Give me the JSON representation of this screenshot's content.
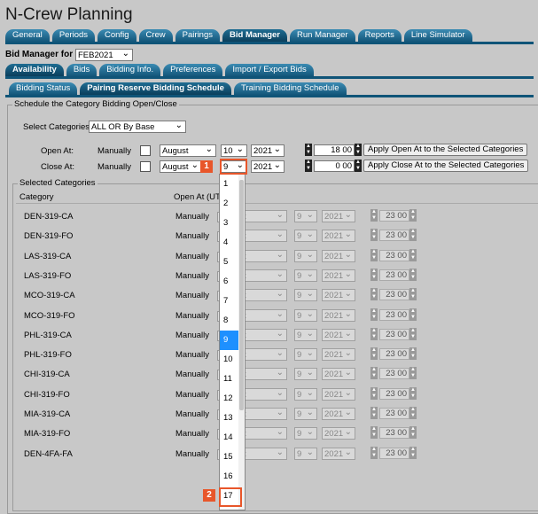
{
  "app_title": "N-Crew Planning",
  "main_tabs": [
    "General",
    "Periods",
    "Config",
    "Crew",
    "Pairings",
    "Bid Manager",
    "Run Manager",
    "Reports",
    "Line Simulator"
  ],
  "active_main_tab": "Bid Manager",
  "bid_manager_label": "Bid Manager for",
  "bid_period": "FEB2021",
  "sub_tabs": [
    "Availability",
    "Bids",
    "Bidding Info.",
    "Preferences",
    "Import / Export Bids"
  ],
  "sub_sub_tabs": [
    "Bidding Status",
    "Pairing Reserve Bidding Schedule",
    "Training Bidding Schedule"
  ],
  "schedule_section": {
    "legend": "Schedule the Category Bidding Open/Close",
    "select_categories_label": "Select Categories",
    "select_categories_value": "ALL OR By Base",
    "open_at": {
      "label": "Open At:",
      "mode": "Manually",
      "month": "August",
      "day": "10",
      "year": "2021",
      "hour": "18",
      "minute": "00",
      "apply": "Apply Open At to the Selected Categories"
    },
    "close_at": {
      "label": "Close At:",
      "mode": "Manually",
      "month": "August",
      "day": "9",
      "year": "2021",
      "hour": "0",
      "minute": "00",
      "apply": "Apply Close At to the Selected Categories"
    }
  },
  "selected_categories": {
    "legend": "Selected Categories",
    "col_category": "Category",
    "col_open_at": "Open At  (UTC",
    "rows": [
      {
        "category": "DEN-319-CA",
        "mode": "Manually",
        "month": "ust",
        "day": "9",
        "year": "2021",
        "hour": "23",
        "minute": "00"
      },
      {
        "category": "DEN-319-FO",
        "mode": "Manually",
        "month": "ust",
        "day": "9",
        "year": "2021",
        "hour": "23",
        "minute": "00"
      },
      {
        "category": "LAS-319-CA",
        "mode": "Manually",
        "month": "ust",
        "day": "9",
        "year": "2021",
        "hour": "23",
        "minute": "00"
      },
      {
        "category": "LAS-319-FO",
        "mode": "Manually",
        "month": "ust",
        "day": "9",
        "year": "2021",
        "hour": "23",
        "minute": "00"
      },
      {
        "category": "MCO-319-CA",
        "mode": "Manually",
        "month": "ust",
        "day": "9",
        "year": "2021",
        "hour": "23",
        "minute": "00"
      },
      {
        "category": "MCO-319-FO",
        "mode": "Manually",
        "month": "ust",
        "day": "9",
        "year": "2021",
        "hour": "23",
        "minute": "00"
      },
      {
        "category": "PHL-319-CA",
        "mode": "Manually",
        "month": "ust",
        "day": "9",
        "year": "2021",
        "hour": "23",
        "minute": "00"
      },
      {
        "category": "PHL-319-FO",
        "mode": "Manually",
        "month": "ust",
        "day": "9",
        "year": "2021",
        "hour": "23",
        "minute": "00"
      },
      {
        "category": "CHI-319-CA",
        "mode": "Manually",
        "month": "ust",
        "day": "9",
        "year": "2021",
        "hour": "23",
        "minute": "00"
      },
      {
        "category": "CHI-319-FO",
        "mode": "Manually",
        "month": "ust",
        "day": "9",
        "year": "2021",
        "hour": "23",
        "minute": "00"
      },
      {
        "category": "MIA-319-CA",
        "mode": "Manually",
        "month": "ust",
        "day": "9",
        "year": "2021",
        "hour": "23",
        "minute": "00"
      },
      {
        "category": "MIA-319-FO",
        "mode": "Manually",
        "month": "ust",
        "day": "9",
        "year": "2021",
        "hour": "23",
        "minute": "00"
      },
      {
        "category": "DEN-4FA-FA",
        "mode": "Manually",
        "month": "ust",
        "day": "9",
        "year": "2021",
        "hour": "23",
        "minute": "00"
      }
    ]
  },
  "day_dropdown": {
    "options": [
      "1",
      "2",
      "3",
      "4",
      "5",
      "6",
      "7",
      "8",
      "9",
      "10",
      "11",
      "12",
      "13",
      "14",
      "15",
      "16",
      "17"
    ],
    "highlighted": "9"
  },
  "callouts": [
    "1",
    "2"
  ],
  "colors": {
    "tab": "#13567a",
    "highlight": "#1e90ff",
    "callout": "#e8562a"
  }
}
